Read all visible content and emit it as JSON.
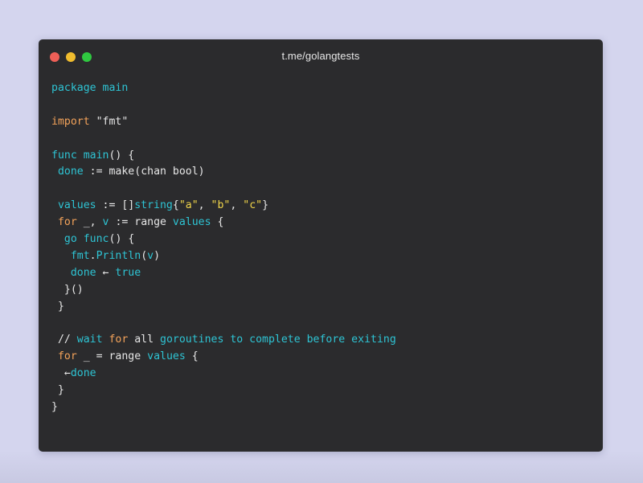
{
  "window": {
    "title": "t.me/golangtests",
    "dots": [
      {
        "name": "close-dot",
        "color": "#ee5f57"
      },
      {
        "name": "minimize-dot",
        "color": "#f0bc2e"
      },
      {
        "name": "maximize-dot",
        "color": "#2fc840"
      }
    ]
  },
  "colors": {
    "plain": "#e6e6e6",
    "keyword": "#2ec4d4",
    "import": "#f4a35a",
    "string": "#f0d54a",
    "builtin": "#2ec4d4",
    "func": "#2ec4d4",
    "comment": "#2ec4d4",
    "bool": "#2ec4d4",
    "range": "#e6e6e6",
    "for": "#f4a35a"
  },
  "code": {
    "lines": [
      [
        {
          "t": "package main",
          "c": "keyword"
        }
      ],
      [],
      [
        {
          "t": "import ",
          "c": "import"
        },
        {
          "t": "\"fmt\"",
          "c": "plain"
        }
      ],
      [],
      [
        {
          "t": "func ",
          "c": "keyword"
        },
        {
          "t": "main",
          "c": "keyword"
        },
        {
          "t": "() {",
          "c": "plain"
        }
      ],
      [
        {
          "t": " ",
          "c": "plain"
        },
        {
          "t": "done",
          "c": "keyword"
        },
        {
          "t": " := ",
          "c": "plain"
        },
        {
          "t": "make",
          "c": "plain"
        },
        {
          "t": "(",
          "c": "plain"
        },
        {
          "t": "chan",
          "c": "plain"
        },
        {
          "t": " bool)",
          "c": "plain"
        }
      ],
      [],
      [
        {
          "t": " ",
          "c": "plain"
        },
        {
          "t": "values",
          "c": "keyword"
        },
        {
          "t": " := []",
          "c": "plain"
        },
        {
          "t": "string",
          "c": "keyword"
        },
        {
          "t": "{",
          "c": "plain"
        },
        {
          "t": "\"a\"",
          "c": "string"
        },
        {
          "t": ", ",
          "c": "plain"
        },
        {
          "t": "\"b\"",
          "c": "string"
        },
        {
          "t": ", ",
          "c": "plain"
        },
        {
          "t": "\"c\"",
          "c": "string"
        },
        {
          "t": "}",
          "c": "plain"
        }
      ],
      [
        {
          "t": " ",
          "c": "plain"
        },
        {
          "t": "for",
          "c": "for"
        },
        {
          "t": " _, ",
          "c": "plain"
        },
        {
          "t": "v",
          "c": "keyword"
        },
        {
          "t": " := ",
          "c": "plain"
        },
        {
          "t": "range",
          "c": "range"
        },
        {
          "t": " ",
          "c": "plain"
        },
        {
          "t": "values",
          "c": "keyword"
        },
        {
          "t": " {",
          "c": "plain"
        }
      ],
      [
        {
          "t": "  ",
          "c": "plain"
        },
        {
          "t": "go",
          "c": "keyword"
        },
        {
          "t": " ",
          "c": "plain"
        },
        {
          "t": "func",
          "c": "keyword"
        },
        {
          "t": "() {",
          "c": "plain"
        }
      ],
      [
        {
          "t": "   ",
          "c": "plain"
        },
        {
          "t": "fmt",
          "c": "keyword"
        },
        {
          "t": ".",
          "c": "plain"
        },
        {
          "t": "Println",
          "c": "keyword"
        },
        {
          "t": "(",
          "c": "plain"
        },
        {
          "t": "v",
          "c": "keyword"
        },
        {
          "t": ")",
          "c": "plain"
        }
      ],
      [
        {
          "t": "   ",
          "c": "plain"
        },
        {
          "t": "done",
          "c": "keyword"
        },
        {
          "t": " ← ",
          "c": "plain"
        },
        {
          "t": "true",
          "c": "keyword"
        }
      ],
      [
        {
          "t": "  }()",
          "c": "plain"
        }
      ],
      [
        {
          "t": " }",
          "c": "plain"
        }
      ],
      [],
      [
        {
          "t": " // ",
          "c": "plain"
        },
        {
          "t": "wait ",
          "c": "keyword"
        },
        {
          "t": "for",
          "c": "for"
        },
        {
          "t": " all ",
          "c": "plain"
        },
        {
          "t": "goroutines to complete before exiting",
          "c": "keyword"
        }
      ],
      [
        {
          "t": " ",
          "c": "plain"
        },
        {
          "t": "for",
          "c": "for"
        },
        {
          "t": " _ = range ",
          "c": "plain"
        },
        {
          "t": "values",
          "c": "keyword"
        },
        {
          "t": " {",
          "c": "plain"
        }
      ],
      [
        {
          "t": "  ←",
          "c": "plain"
        },
        {
          "t": "done",
          "c": "keyword"
        }
      ],
      [
        {
          "t": " }",
          "c": "plain"
        }
      ],
      [
        {
          "t": "}",
          "c": "plain"
        }
      ]
    ]
  }
}
